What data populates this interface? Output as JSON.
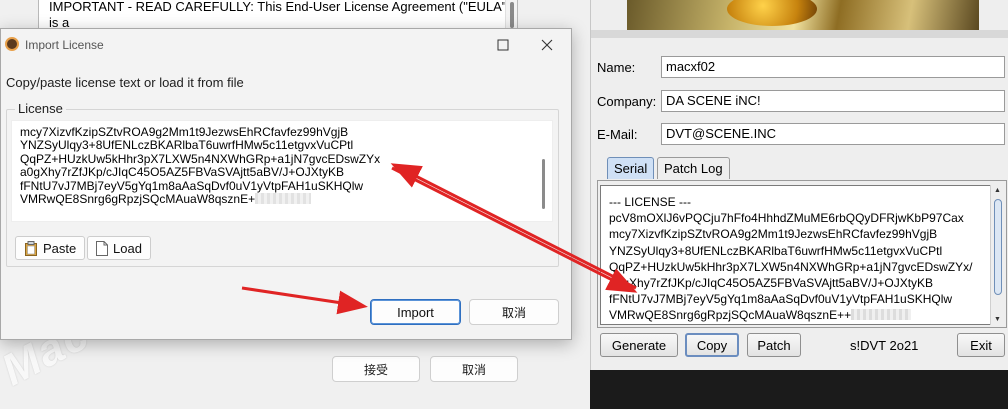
{
  "installer": {
    "eula_text": "IMPORTANT - READ CAREFULLY: This End-User License Agreement (\"EULA\") is a",
    "accept_label": "接受",
    "cancel_label": "取消",
    "watermark": "MacV"
  },
  "import_dialog": {
    "title": "Import License",
    "instruction": "Copy/paste license text or load it from file",
    "group_label": "License",
    "license_lines": [
      "mcy7XizvfKzipSZtvROA9g2Mm1t9JezwsEhRCfavfez99hVgjB",
      "YNZSyUlqy3+8UfENLczBKARlbaT6uwrfHMw5c11etgvxVuCPtl",
      "QqPZ+HUzkUw5kHhr3pX7LXW5n4NXWhGRp+a1jN7gvcEDswZYx",
      "a0gXhy7rZfJKp/cJIqC45O5AZ5FBVaSVAjtt5aBV/J+OJXtyKB",
      "fFNtU7vJ7MBj7eyV5gYq1m8aAaSqDvf0uV1yVtpFAH1uSKHQlw",
      "VMRwQE8Snrg6gRpzjSQcMAuaW8qsznE+"
    ],
    "paste_label": "Paste",
    "load_label": "Load",
    "import_label": "Import",
    "cancel_label": "取消"
  },
  "keygen": {
    "name_label": "Name:",
    "name_value": "macxf02",
    "company_label": "Company:",
    "company_value": "DA SCENE iNC!",
    "email_label": "E-Mail:",
    "email_value": "DVT@SCENE.INC",
    "tabs": [
      "Serial",
      "Patch Log"
    ],
    "serial_lines": [
      "--- LICENSE ---",
      "pcV8mOXlJ6vPQCju7hFfo4HhhdZMuME6rbQQyDFRjwKbP97Cax",
      "mcy7XizvfKzipSZtvROA9g2Mm1t9JezwsEhRCfavfez99hVgjB",
      "YNZSyUlqy3+8UfENLczBKARlbaT6uwrfHMw5c11etgvxVuCPtl",
      "QqPZ+HUzkUw5kHhr3pX7LXW5n4NXWhGRp+a1jN7gvcEDswZYx/",
      "a0gXhy7rZfJKp/cJIqC45O5AZ5FBVaSVAjtt5aBV/J+OJXtyKB",
      "fFNtU7vJ7MBj7eyV5gYq1m8aAaSqDvf0uV1yVtpFAH1uSKHQlw",
      "VMRwQE8Snrg6gRpzjSQcMAuaW8qsznE++"
    ],
    "generate_label": "Generate",
    "copy_label": "Copy",
    "patch_label": "Patch",
    "credit": "s!DVT 2o21",
    "exit_label": "Exit"
  },
  "colors": {
    "annotation_arrow": "#e02424",
    "dialog_background": "#f3f3f3",
    "keygen_background": "#eeeeee",
    "focus_blue": "#2f6fc0"
  }
}
